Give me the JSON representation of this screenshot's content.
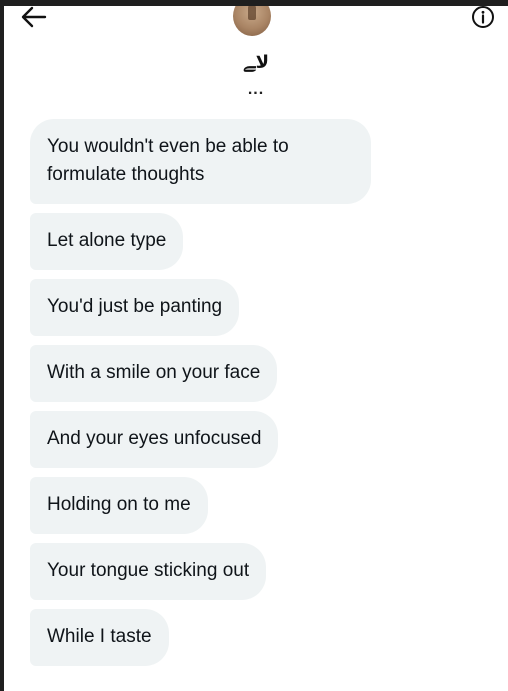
{
  "header": {
    "back_icon": "arrow-left-icon",
    "info_icon": "info-circle-icon",
    "avatar_icon": "avatar",
    "username": "ﻻﮯ",
    "typing_indicator": "..."
  },
  "messages": [
    {
      "text": "You wouldn't even be able to formulate thoughts"
    },
    {
      "text": "Let alone type"
    },
    {
      "text": "You'd just be panting"
    },
    {
      "text": "With a smile on your face"
    },
    {
      "text": "And your eyes unfocused"
    },
    {
      "text": "Holding on to me"
    },
    {
      "text": "Your tongue sticking out"
    },
    {
      "text": "While I taste"
    }
  ],
  "colors": {
    "bubble_bg": "#eff3f4",
    "text": "#0f1419",
    "background": "#ffffff"
  }
}
